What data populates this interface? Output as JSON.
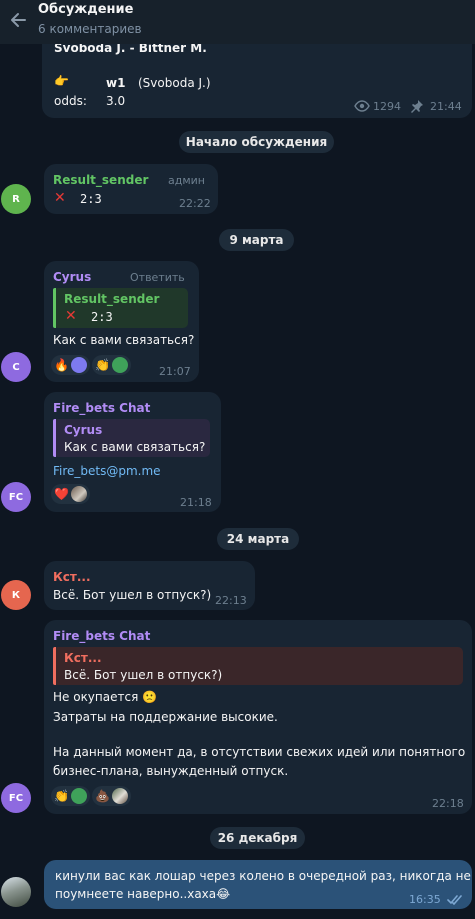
{
  "header": {
    "title": "Обсуждение",
    "subtitle": "6 комментариев"
  },
  "post": {
    "teams": "Svoboda J.  -  Bittner M.",
    "pick_emoji": "👉",
    "pick": "w1",
    "pick_note": "(Svoboda J.)",
    "odds_label": "odds:",
    "odds_value": "3.0",
    "views": "1294",
    "time": "21:44"
  },
  "dividers": {
    "start": "Начало обсуждения",
    "d1": "9 марта",
    "d2": "24 марта",
    "d3": "26 декабря"
  },
  "messages": [
    {
      "avatar": "R",
      "avatar_color": "#5fb44e",
      "author": "Result_sender",
      "author_color": "#62c564",
      "role": "админ",
      "text": "2:3",
      "time": "22:22"
    },
    {
      "avatar": "C",
      "avatar_color": "#8e6ae0",
      "author": "Cyrus",
      "author_color": "#b18cf5",
      "reply_action": "Ответить",
      "quote_author": "Result_sender",
      "quote_color": "#62c564",
      "quote_text": "2:3",
      "text": "Как с вами связаться?",
      "time": "21:07"
    },
    {
      "avatar": "FC",
      "avatar_color": "#8e6ae0",
      "author": "Fire_bets Chat",
      "author_color": "#b18cf5",
      "quote_author": "Cyrus",
      "quote_color": "#b18cf5",
      "quote_text": "Как с вами связаться?",
      "text": "Fire_bets@pm.me",
      "time": "21:18"
    },
    {
      "avatar": "К",
      "avatar_color": "#e5664f",
      "author": "Кст...",
      "author_color": "#f06e5f",
      "text": "Всё. Бот ушел в отпуск?)",
      "time": "22:13"
    },
    {
      "avatar": "FC",
      "avatar_color": "#8e6ae0",
      "author": "Fire_bets Chat",
      "author_color": "#b18cf5",
      "quote_author": "Кст...",
      "quote_color": "#f06e5f",
      "quote_text": "Всё. Бот ушел в отпуск?)",
      "lines": [
        "Не окупается 🙁",
        "Затраты на поддержание высокие.",
        "На данный момент да, в отсутствии свежих идей или понятного",
        "бизнес-плана, вынужденный отпуск."
      ],
      "time": "22:18"
    },
    {
      "lines": [
        "кинули вас как лошар через колено в очередной раз, никогда не",
        "поумнеете наверно..хаха😂"
      ],
      "time": "16:35"
    }
  ],
  "reactions": {
    "m2": [
      "🔥",
      "👏"
    ],
    "m3": [
      "❤️"
    ],
    "m5": [
      "👏",
      "💩"
    ]
  },
  "icons": {
    "back": "arrow-left-icon",
    "views": "eye-icon",
    "pin": "pin-icon",
    "ticks": "double-check-icon"
  }
}
